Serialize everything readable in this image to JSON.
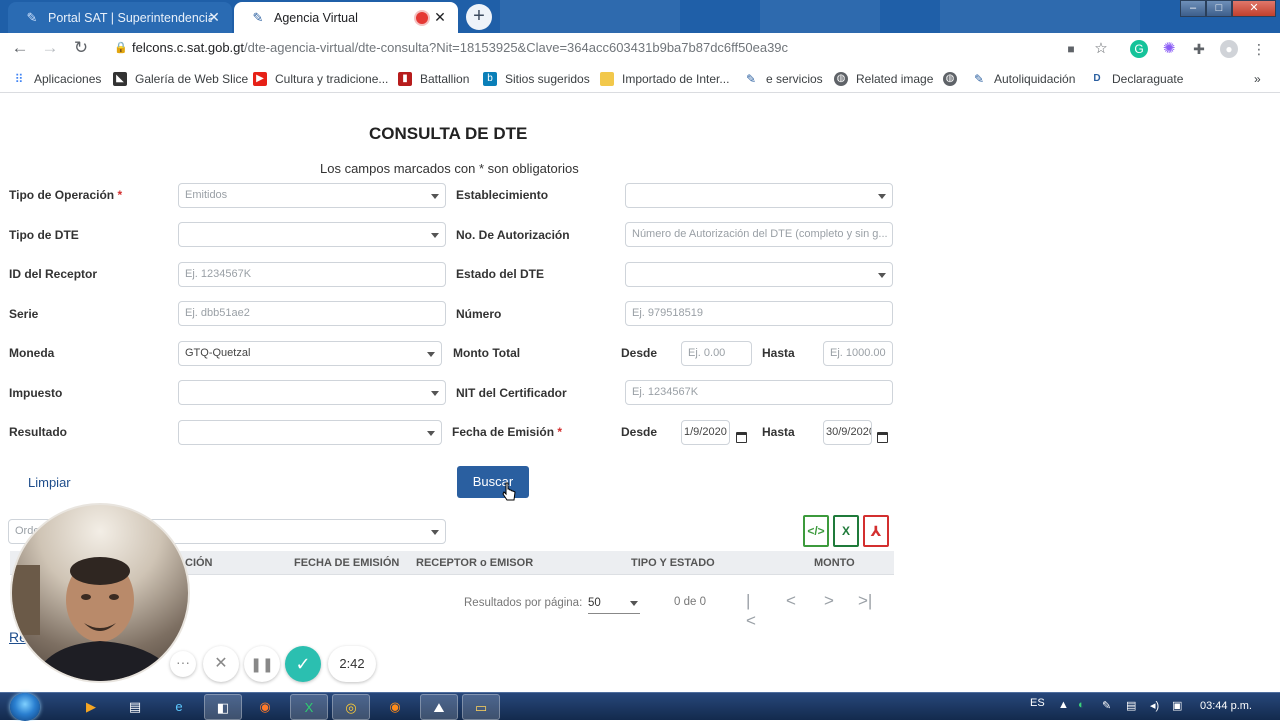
{
  "browser": {
    "tabs": [
      {
        "label": "Portal SAT | Superintendencia de",
        "active": false
      },
      {
        "label": "Agencia Virtual",
        "active": true
      }
    ],
    "url_host": "felcons.c.sat.gob.gt",
    "url_path": "/dte-agencia-virtual/dte-consulta?Nit=18153925&Clave=364acc603431b9ba7b87dc6ff50ea39c",
    "bookmarks": [
      "Aplicaciones",
      "Galería de Web Slice",
      "Cultura y tradicione...",
      "Battallion",
      "Sitios sugeridos",
      "Importado de Inter...",
      "e servicios",
      "Related image",
      "",
      "Autoliquidación",
      "Declaraguate"
    ],
    "more_bookmarks": "»"
  },
  "form": {
    "title": "CONSULTA DE DTE",
    "required_note": "Los campos marcados con * son obligatorios",
    "labels": {
      "tipo_operacion": "Tipo de Operación",
      "establecimiento": "Establecimiento",
      "tipo_dte": "Tipo de DTE",
      "no_autorizacion": "No. De Autorización",
      "id_receptor": "ID del Receptor",
      "estado_dte": "Estado del DTE",
      "serie": "Serie",
      "numero": "Número",
      "moneda": "Moneda",
      "monto_total": "Monto Total",
      "desde": "Desde",
      "hasta": "Hasta",
      "impuesto": "Impuesto",
      "nit_certificador": "NIT del Certificador",
      "resultado": "Resultado",
      "fecha_emision": "Fecha de Emisión",
      "required_mark": "*"
    },
    "values": {
      "tipo_operacion": "Emitidos",
      "moneda": "GTQ-Quetzal",
      "fecha_desde": "1/9/2020",
      "fecha_hasta": "30/9/2020"
    },
    "placeholders": {
      "no_autorizacion": "Número de Autorización del DTE (completo y sin g...",
      "id_receptor": "Ej. 1234567K",
      "serie": "Ej. dbb51ae2",
      "numero": "Ej. 979518519",
      "monto_desde": "Ej. 0.00",
      "monto_hasta": "Ej. 1000.00",
      "nit_certificador": "Ej. 1234567K",
      "orden": "Orde"
    },
    "clear_label": "Limpiar",
    "search_label": "Buscar"
  },
  "downloads": [
    "XML",
    "Excel",
    "PDF"
  ],
  "table": {
    "headers": [
      "CIÓN",
      "FECHA DE EMISIÓN",
      "RECEPTOR o EMISOR",
      "TIPO Y ESTADO",
      "MONTO"
    ]
  },
  "pager": {
    "label": "Resultados por página:",
    "per_page": "50",
    "range": "0 de 0"
  },
  "left_link": "Re",
  "recorder": {
    "time": "2:42"
  },
  "taskbar": {
    "lang": "ES",
    "clock": "03:44 p.m."
  },
  "colors": {
    "accent": "#2a5fa0",
    "required": "#d32f2f",
    "xml_icon": "#3c9a3c",
    "excel_icon": "#1f7a3a",
    "pdf_icon": "#d32f2f",
    "record_check": "#2bbfb0"
  }
}
